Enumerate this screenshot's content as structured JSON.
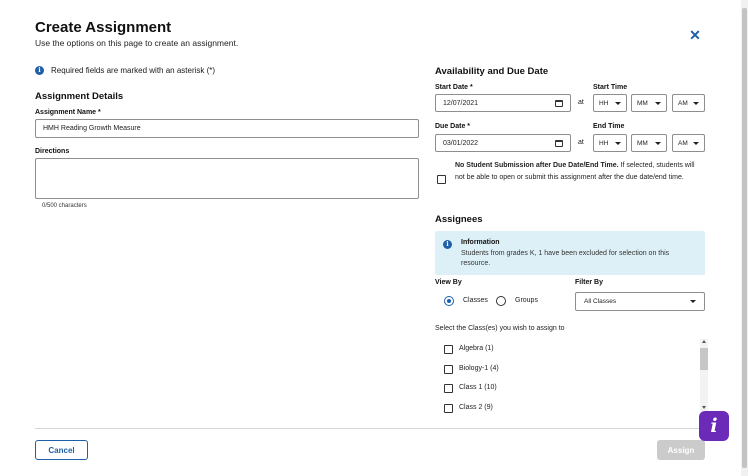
{
  "header": {
    "title": "Create Assignment",
    "subtitle": "Use the options on this page to create an assignment.",
    "close_icon": "close-icon"
  },
  "required_note": "Required fields are marked with an asterisk (*)",
  "details": {
    "heading": "Assignment Details",
    "name_label": "Assignment Name *",
    "name_value": "HMH Reading Growth Measure",
    "directions_label": "Directions",
    "directions_value": "",
    "char_count": "0/500 characters"
  },
  "availability": {
    "heading": "Availability and Due Date",
    "start_date_label": "Start Date *",
    "start_date_value": "12/07/2021",
    "start_time_label": "Start Time",
    "due_date_label": "Due Date *",
    "due_date_value": "03/01/2022",
    "end_time_label": "End Time",
    "at_label": "at",
    "hour_placeholder": "HH",
    "minute_placeholder": "MM",
    "ampm_value": "AM",
    "no_submission_bold": "No Student Submission after Due Date/End Time.",
    "no_submission_rest": " If selected, students will not be able to open or submit this assignment after the due date/end time.",
    "no_submission_checked": false
  },
  "assignees": {
    "heading": "Assignees",
    "info_title": "Information",
    "info_body": "Students from grades K, 1 have been excluded for selection on this resource.",
    "view_by_label": "View By",
    "view_options": [
      "Classes",
      "Groups"
    ],
    "view_selected": "Classes",
    "filter_by_label": "Filter By",
    "filter_value": "All Classes",
    "select_prompt": "Select the Class(es) you wish to assign to",
    "classes": [
      {
        "label": "Algebra (1)",
        "checked": false
      },
      {
        "label": "Biology-1 (4)",
        "checked": false
      },
      {
        "label": "Class 1 (10)",
        "checked": false
      },
      {
        "label": "Class 2 (9)",
        "checked": false
      }
    ]
  },
  "footer": {
    "cancel_label": "Cancel",
    "assign_label": "Assign"
  },
  "colors": {
    "accent": "#1f5fa8",
    "info_bg": "#def0f7",
    "help_purple": "#6b2bb8",
    "disabled_btn": "#cbcbcb"
  }
}
